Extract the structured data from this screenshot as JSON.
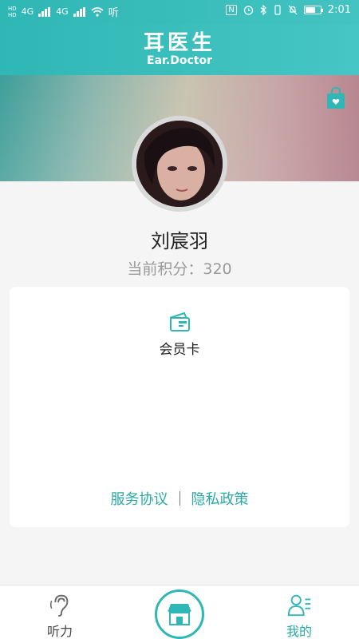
{
  "status_bar": {
    "hd_top": "HD",
    "hd_bottom": "HD",
    "net1": "4G",
    "net2": "4G",
    "extra": "听",
    "nfc": "N",
    "time": "2:01"
  },
  "app": {
    "title_cn": "耳医生",
    "title_en": "Ear.Doctor"
  },
  "profile": {
    "name": "刘宸羽",
    "points_label": "当前积分：",
    "points_value": "320"
  },
  "card": {
    "member_card_label": "会员卡",
    "service_agreement": "服务协议",
    "separator": "|",
    "privacy_policy": "隐私政策"
  },
  "bottom_nav": {
    "hearing_label": "听力",
    "mine_label": "我的"
  },
  "colors": {
    "accent": "#2fb7b5",
    "link": "#2aa9a6"
  }
}
